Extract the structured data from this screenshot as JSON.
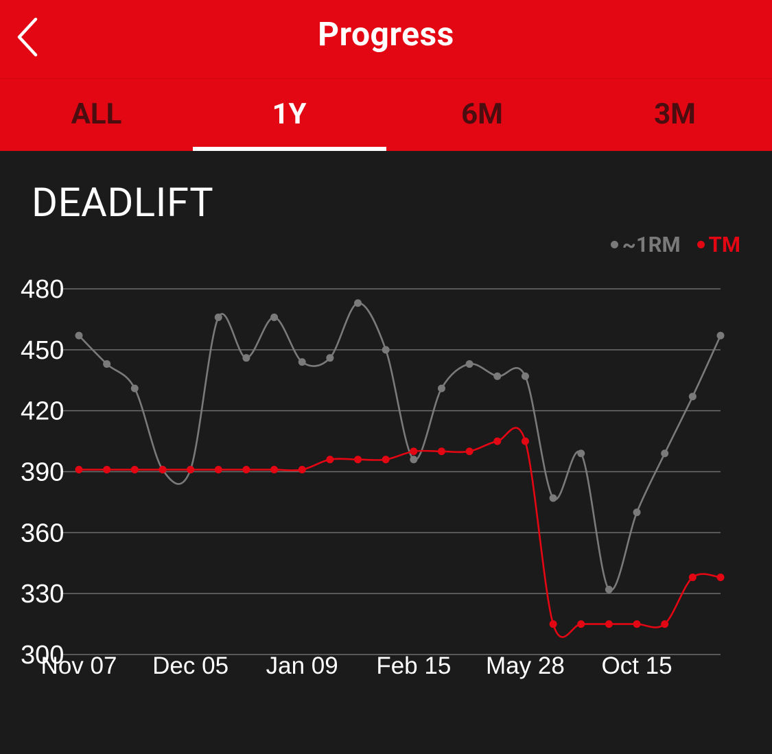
{
  "header": {
    "title": "Progress",
    "back_icon": "chevron-left-icon"
  },
  "tabs": [
    {
      "label": "ALL",
      "active": false
    },
    {
      "label": "1Y",
      "active": true
    },
    {
      "label": "6M",
      "active": false
    },
    {
      "label": "3M",
      "active": false
    }
  ],
  "colors": {
    "accent": "#e30613",
    "background": "#1b1b1b",
    "series_1rm": "#7a7a7a",
    "series_tm": "#e30613",
    "inactive_tab_text": "#4a0d10"
  },
  "card": {
    "title": "DEADLIFT"
  },
  "chart_data": {
    "type": "line",
    "title": "DEADLIFT",
    "legend": {
      "placement": "top-right"
    },
    "grid": true,
    "ylim": [
      300,
      480
    ],
    "y_ticks": [
      "480",
      "450",
      "420",
      "390",
      "360",
      "330",
      "300"
    ],
    "x_tick_labels": [
      "Nov 07",
      "Dec 05",
      "Jan 09",
      "Feb 15",
      "May 28",
      "Oct 15"
    ],
    "x_tick_indices": [
      0,
      4,
      8,
      12,
      16,
      20
    ],
    "series": [
      {
        "name": "~1RM",
        "color": "#7a7a7a",
        "values": [
          457,
          443,
          431,
          391,
          391,
          466,
          446,
          466,
          444,
          446,
          473,
          450,
          396,
          431,
          443,
          437,
          437,
          377,
          399,
          332,
          370,
          399,
          427,
          457
        ]
      },
      {
        "name": "TM",
        "color": "#e30613",
        "values": [
          391,
          391,
          391,
          391,
          391,
          391,
          391,
          391,
          391,
          396,
          396,
          396,
          400,
          400,
          400,
          405,
          405,
          315,
          315,
          315,
          315,
          315,
          338,
          338
        ]
      }
    ]
  }
}
